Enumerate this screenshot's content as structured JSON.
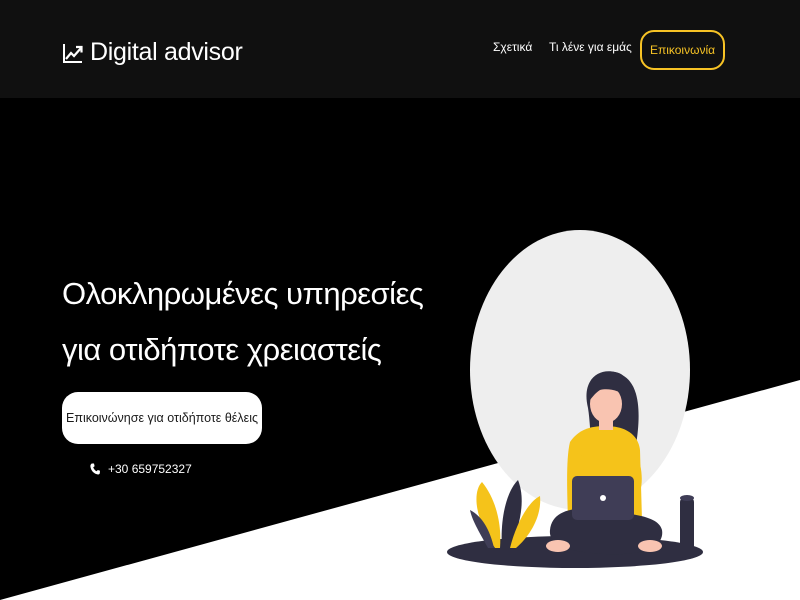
{
  "header": {
    "brand_name": "Digital advisor",
    "brand_icon": "trending-up-icon",
    "nav": {
      "about_label": "Σχετικά",
      "reviews_label": "Τι λένε για εμάς"
    },
    "contact_button_label": "Επικοινωνία"
  },
  "hero": {
    "title_line1": "Ολοκληρωμένες υπηρεσίες",
    "title_line2": "για οτιδήποτε χρειαστείς",
    "cta_label": "Επικοινώνησε για οτιδήποτε θέλεις",
    "phone_icon": "phone-icon",
    "phone_number": "+30 659752327"
  },
  "colors": {
    "accent": "#f7c325",
    "background": "#000000",
    "header_background": "#101010",
    "diagonal_white": "#ffffff",
    "shirt_yellow": "#f5c31a"
  },
  "illustration": {
    "icon_name": "woman-working-on-laptop-illustration"
  }
}
